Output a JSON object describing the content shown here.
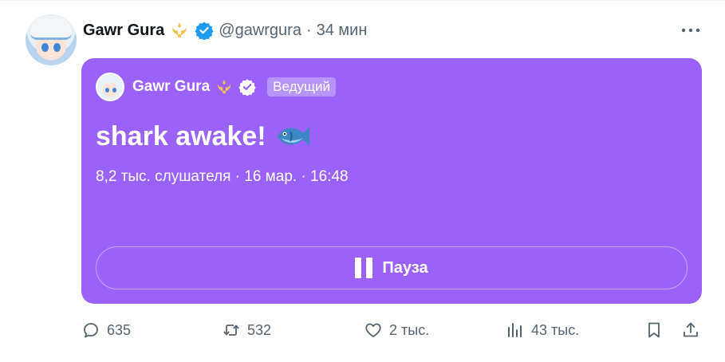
{
  "tweet": {
    "author_name": "Gawr Gura",
    "author_handle": "@gawrgura",
    "separator": "·",
    "time": "34 мин",
    "crest_icon": "trident-crest-icon",
    "verified_icon": "verified-badge-icon"
  },
  "space": {
    "host_name": "Gawr Gura",
    "host_role": "Ведущий",
    "title": "shark awake!",
    "title_emoji": "fish-emoji",
    "meta": "8,2 тыс. слушателя · 16 мар. · 16:48",
    "pause_label": "Пауза",
    "card_color": "#9a62f8"
  },
  "actions": {
    "replies": "635",
    "retweets": "532",
    "likes": "2 тыс.",
    "views": "43 тыс."
  },
  "colors": {
    "text_primary": "#0f1419",
    "text_secondary": "#536471",
    "verified": "#1d9bf0",
    "crest": "#f2c14e"
  }
}
